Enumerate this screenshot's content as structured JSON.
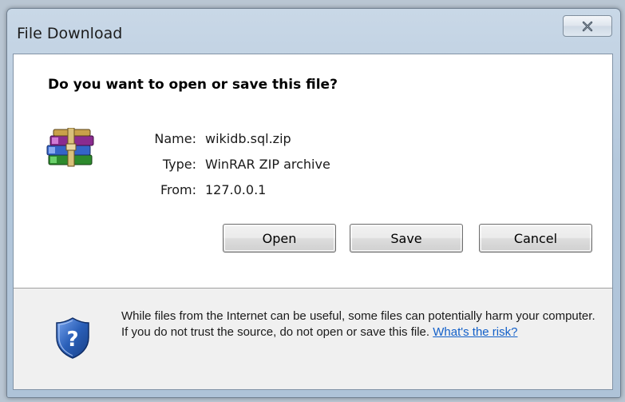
{
  "window": {
    "title": "File Download",
    "close_icon": "close-x-icon"
  },
  "dialog": {
    "question": "Do you want to open or save this file?",
    "file_icon": "winrar-archive-icon",
    "file": {
      "name_label": "Name:",
      "name_value": "wikidb.sql.zip",
      "type_label": "Type:",
      "type_value": "WinRAR ZIP archive",
      "from_label": "From:",
      "from_value": "127.0.0.1"
    },
    "buttons": {
      "open": "Open",
      "save": "Save",
      "cancel": "Cancel"
    }
  },
  "security": {
    "icon": "security-shield-question-icon",
    "warning_text": "While files from the Internet can be useful, some files can potentially harm your computer. If you do not trust the source, do not open or save this file.",
    "risk_link": "What's the risk?"
  },
  "colors": {
    "link": "#1360c9",
    "shield_blue": "#2a5fb8"
  }
}
